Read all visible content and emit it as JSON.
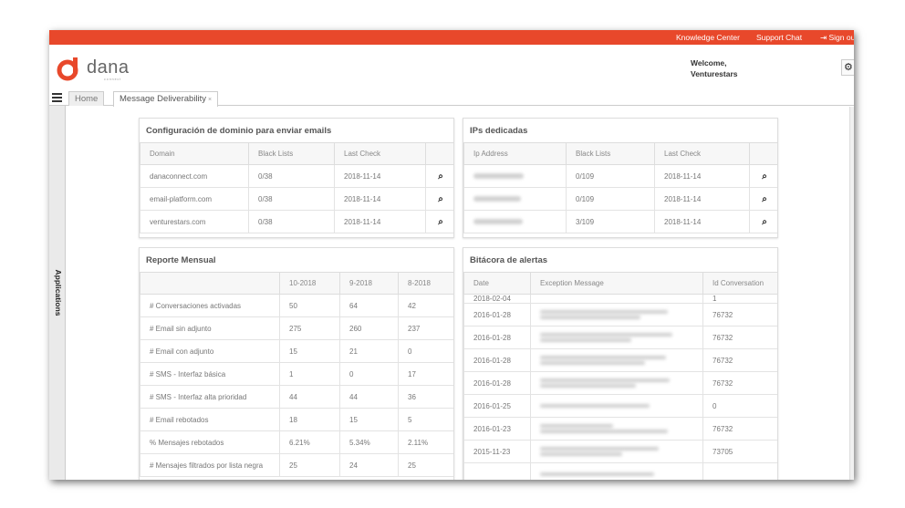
{
  "topbar": {
    "knowledge_center": "Knowledge Center",
    "support_chat": "Support Chat",
    "sign_out": "Sign ou"
  },
  "brand": {
    "name": "dana",
    "sub": "connect",
    "accent": "#e8482b"
  },
  "user": {
    "welcome": "Welcome,",
    "name": "Venturestars"
  },
  "tabs": [
    {
      "label": "Home"
    },
    {
      "label": "Message Deliverability",
      "close": "×"
    }
  ],
  "sidebar": {
    "label": "Applications"
  },
  "domains": {
    "title": "Configuración de dominio para enviar emails",
    "headers": [
      "Domain",
      "Black Lists",
      "Last Check",
      ""
    ],
    "rows": [
      {
        "domain": "danaconnect.com",
        "blacklists": "0/38",
        "last_check": "2018-11-14"
      },
      {
        "domain": "email-platform.com",
        "blacklists": "0/38",
        "last_check": "2018-11-14"
      },
      {
        "domain": "venturestars.com",
        "blacklists": "0/38",
        "last_check": "2018-11-14"
      }
    ]
  },
  "ips": {
    "title": "IPs dedicadas",
    "headers": [
      "Ip Address",
      "Black Lists",
      "Last Check",
      ""
    ],
    "rows": [
      {
        "blacklists": "0/109",
        "last_check": "2018-11-14"
      },
      {
        "blacklists": "0/109",
        "last_check": "2018-11-14"
      },
      {
        "blacklists": "3/109",
        "last_check": "2018-11-14"
      }
    ]
  },
  "report": {
    "title": "Reporte Mensual",
    "headers": [
      "",
      "10-2018",
      "9-2018",
      "8-2018"
    ],
    "rows": [
      {
        "label": "# Conversaciones activadas",
        "v1": "50",
        "v2": "64",
        "v3": "42"
      },
      {
        "label": "# Email sin adjunto",
        "v1": "275",
        "v2": "260",
        "v3": "237"
      },
      {
        "label": "# Email con adjunto",
        "v1": "15",
        "v2": "21",
        "v3": "0"
      },
      {
        "label": "# SMS - Interfaz básica",
        "v1": "1",
        "v2": "0",
        "v3": "17"
      },
      {
        "label": "# SMS - Interfaz alta prioridad",
        "v1": "44",
        "v2": "44",
        "v3": "36"
      },
      {
        "label": "# Email rebotados",
        "v1": "18",
        "v2": "15",
        "v3": "5"
      },
      {
        "label": "% Mensajes rebotados",
        "v1": "6.21%",
        "v2": "5.34%",
        "v3": "2.11%"
      },
      {
        "label": "# Mensajes filtrados por lista negra",
        "v1": "25",
        "v2": "24",
        "v3": "25"
      }
    ]
  },
  "alerts": {
    "title": "Bitácora de alertas",
    "headers": [
      "Date",
      "Exception Message",
      "Id Conversation"
    ],
    "rows": [
      {
        "date": "2018-02-04",
        "id": "1"
      },
      {
        "date": "2016-01-28",
        "id": "76732"
      },
      {
        "date": "2016-01-28",
        "id": "76732"
      },
      {
        "date": "2016-01-28",
        "id": "76732"
      },
      {
        "date": "2016-01-28",
        "id": "76732"
      },
      {
        "date": "2016-01-25",
        "id": "0"
      },
      {
        "date": "2016-01-23",
        "id": "76732"
      },
      {
        "date": "2015-11-23",
        "id": "73705"
      }
    ]
  }
}
